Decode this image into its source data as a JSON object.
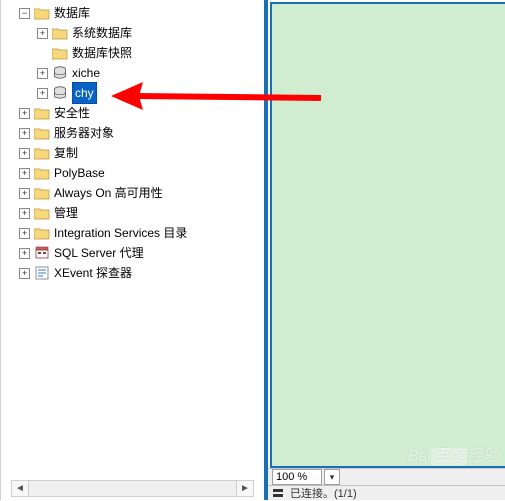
{
  "tree": {
    "databases": {
      "label": "数据库",
      "children": {
        "sysdb": "系统数据库",
        "snapshot": "数据库快照",
        "xiche": "xiche",
        "chy": "chy"
      }
    },
    "security": "安全性",
    "server_objects": "服务器对象",
    "replication": "复制",
    "polybase": "PolyBase",
    "alwayson": "Always On 高可用性",
    "management": "管理",
    "integration": "Integration Services 目录",
    "sqlagent": "SQL Server 代理",
    "xevent": "XEvent 探查器"
  },
  "selected_node": "chy",
  "zoom": {
    "value": "100 %"
  },
  "status": {
    "connection": "已连接。(1/1)"
  },
  "watermark": {
    "brand": "Bai",
    "brand2": "百度",
    "text": "经验"
  },
  "icons": {
    "folder_fill": "#f7d77b",
    "folder_stroke": "#b8923d",
    "db_fill": "#e0e0e0",
    "db_stroke": "#555"
  }
}
